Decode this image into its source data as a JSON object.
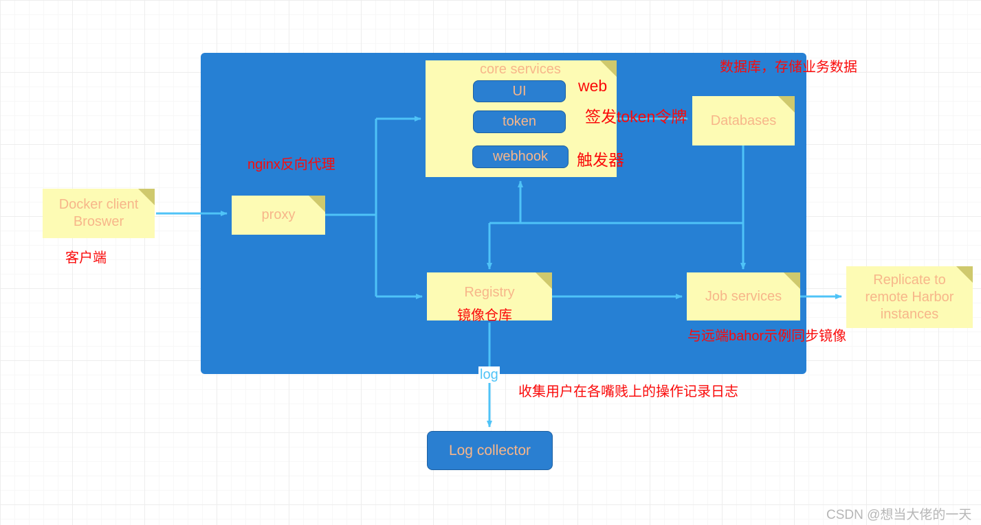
{
  "diagram": {
    "title": "Harbor architecture",
    "container_label": "",
    "colors": {
      "container": "#2680d4",
      "note_fill": "#fdfbb4",
      "note_fold": "#cfc96d",
      "note_text": "#f7b68a",
      "chip_fill": "#2a7fd1",
      "chip_text": "#f7b68a",
      "arrow": "#4fc3f7",
      "annotation": "#fa0a0a",
      "grid": "#ededed",
      "background": "#ffffff"
    }
  },
  "nodes": {
    "docker_client": {
      "line1": "Docker client",
      "line2": "Broswer"
    },
    "proxy": {
      "label": "proxy"
    },
    "core_services": {
      "title": "core services"
    },
    "ui": {
      "label": "UI"
    },
    "token": {
      "label": "token"
    },
    "webhook": {
      "label": "webhook"
    },
    "databases": {
      "label": "Databases"
    },
    "registry": {
      "label": "Registry"
    },
    "job_services": {
      "label": "Job services"
    },
    "replicate": {
      "line1": "Replicate to",
      "line2": "remote Harbor",
      "line3": "instances"
    },
    "log_collector": {
      "label": "Log collector"
    }
  },
  "edge_labels": {
    "log": "log"
  },
  "annotations": {
    "client": "客户端",
    "nginx_proxy": "nginx反向代理",
    "web": "web",
    "token_sign": "签发token令牌",
    "trigger": "触发器",
    "database_desc": "数据库，存储业务数据",
    "registry_desc": "镜像仓库",
    "replicate_desc": "与远端bahor示例同步镜像",
    "log_desc": "收集用户在各嘴贱上的操作记录日志"
  },
  "watermark": {
    "text": "CSDN @想当大佬的一天"
  }
}
